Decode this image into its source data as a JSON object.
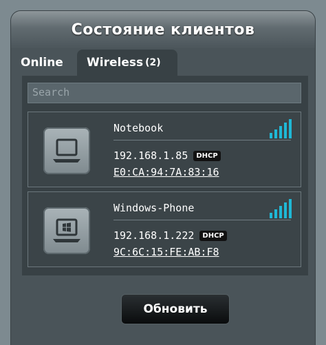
{
  "panel": {
    "title": "Состояние клиентов"
  },
  "tabs": [
    {
      "label": "Online",
      "active": false
    },
    {
      "label": "Wireless",
      "count": "(2)",
      "active": true
    }
  ],
  "search": {
    "placeholder": "Search"
  },
  "clients": [
    {
      "name": "Notebook",
      "ip": "192.168.1.85",
      "type": "DHCP",
      "mac": "E0:CA:94:7A:83:16",
      "icon": "laptop-icon",
      "signal_bars": 5
    },
    {
      "name": "Windows-Phone",
      "ip": "192.168.1.222",
      "type": "DHCP",
      "mac": "9C:6C:15:FE:AB:F8",
      "icon": "windows-laptop-icon",
      "signal_bars": 5
    }
  ],
  "refresh_button": {
    "label": "Обновить"
  },
  "colors": {
    "signal": "#1fb8d6",
    "panel": "#4a5459",
    "content": "#384145"
  }
}
